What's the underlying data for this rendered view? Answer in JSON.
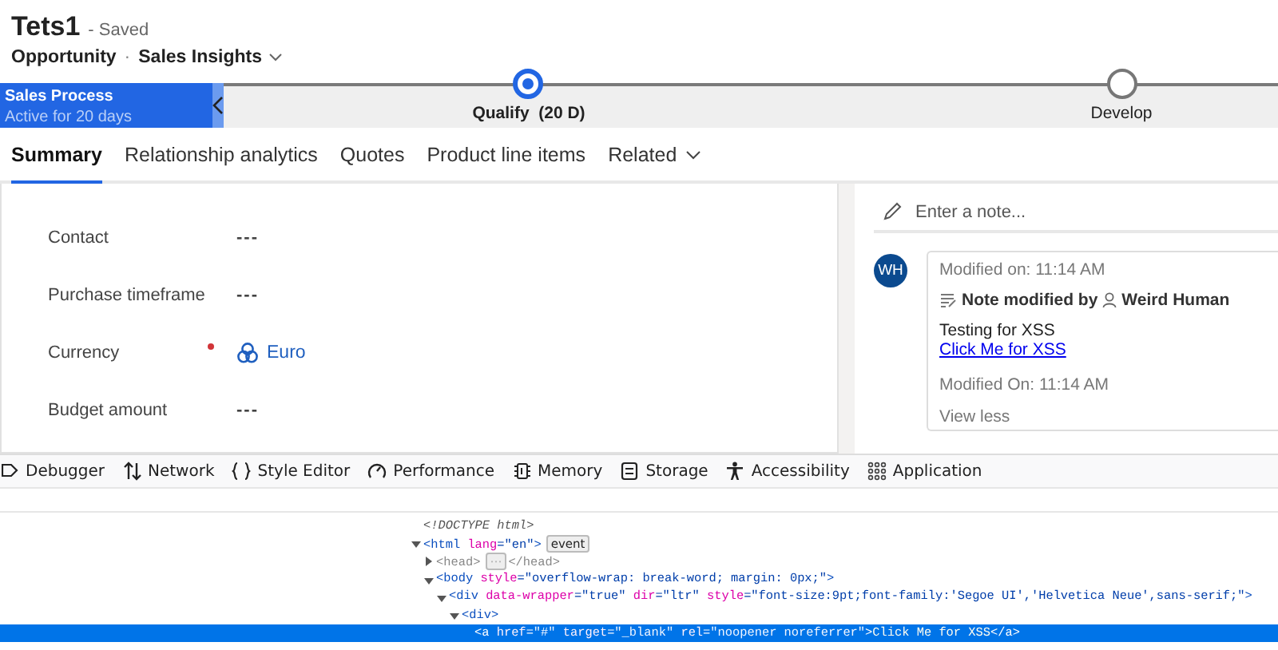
{
  "header": {
    "title": "Tets1",
    "save_status": "- Saved",
    "entity": "Opportunity",
    "separator": "·",
    "form_selector": "Sales Insights"
  },
  "process": {
    "name": "Sales Process",
    "duration": "Active for 20 days",
    "stages": [
      {
        "label": "Qualify",
        "days": "(20 D)",
        "selected": true
      },
      {
        "label": "Develop",
        "selected": false
      }
    ]
  },
  "tabs": [
    {
      "label": "Summary",
      "selected": true,
      "kind": "tab"
    },
    {
      "label": "Relationship analytics",
      "selected": false,
      "kind": "tab"
    },
    {
      "label": "Quotes",
      "selected": false,
      "kind": "tab"
    },
    {
      "label": "Product line items",
      "selected": false,
      "kind": "tab"
    },
    {
      "label": "Related",
      "selected": false,
      "kind": "menu"
    }
  ],
  "fields": [
    {
      "label": "Contact",
      "value": "---",
      "required": false,
      "kind": "text"
    },
    {
      "label": "Purchase timeframe",
      "value": "---",
      "required": false,
      "kind": "text"
    },
    {
      "label": "Currency",
      "value": "Euro",
      "required": true,
      "kind": "lookup"
    },
    {
      "label": "Budget amount",
      "value": "---",
      "required": false,
      "kind": "text"
    }
  ],
  "notes": {
    "placeholder": "Enter a note...",
    "entries": [
      {
        "initials": "WH",
        "modified": "Modified on: 11:14 AM",
        "action": "Note modified by",
        "author": "Weird Human",
        "body": "Testing for XSS",
        "link": "Click Me for XSS",
        "footer": "Modified On: 11:14 AM",
        "toggle": "View less"
      }
    ]
  },
  "devtools": {
    "tools": [
      {
        "label": "Debugger",
        "kind": "debugger"
      },
      {
        "label": "Network",
        "kind": "network"
      },
      {
        "label": "Style Editor",
        "kind": "style"
      },
      {
        "label": "Performance",
        "kind": "performance"
      },
      {
        "label": "Memory",
        "kind": "memory"
      },
      {
        "label": "Storage",
        "kind": "storage"
      },
      {
        "label": "Accessibility",
        "kind": "accessibility"
      },
      {
        "label": "Application",
        "kind": "application"
      }
    ],
    "dom_tree": [
      {
        "kind": "leaf",
        "selected": false,
        "dimmed": false,
        "tokens": [
          {
            "kind": "doctype",
            "text": "<!DOCTYPE html>"
          }
        ]
      },
      {
        "kind": "parent",
        "expanded": true,
        "selected": false,
        "dimmed": false,
        "tokens": [
          {
            "kind": "tag",
            "text": "<html"
          },
          {
            "kind": "attr",
            "text": " lang"
          },
          {
            "kind": "value",
            "text": "=\"en\""
          },
          {
            "kind": "tag",
            "text": ">"
          },
          {
            "kind": "badge",
            "text": "event"
          }
        ],
        "children": [
          {
            "kind": "parent",
            "expanded": false,
            "selected": false,
            "dimmed": true,
            "tokens": [
              {
                "kind": "tag",
                "text": "<head>"
              },
              {
                "kind": "badge",
                "text": "⋯"
              },
              {
                "kind": "tag",
                "text": "</head>"
              }
            ]
          },
          {
            "kind": "parent",
            "expanded": true,
            "selected": false,
            "dimmed": false,
            "tokens": [
              {
                "kind": "tag",
                "text": "<body"
              },
              {
                "kind": "attr",
                "text": " style"
              },
              {
                "kind": "value",
                "text": "=\"overflow-wrap: break-word; margin: 0px;\""
              },
              {
                "kind": "tag",
                "text": ">"
              }
            ],
            "children": [
              {
                "kind": "parent",
                "expanded": true,
                "selected": false,
                "dimmed": false,
                "tokens": [
                  {
                    "kind": "tag",
                    "text": "<div"
                  },
                  {
                    "kind": "attr",
                    "text": " data-wrapper"
                  },
                  {
                    "kind": "value",
                    "text": "=\"true\""
                  },
                  {
                    "kind": "attr",
                    "text": " dir"
                  },
                  {
                    "kind": "value",
                    "text": "=\"ltr\""
                  },
                  {
                    "kind": "attr",
                    "text": " style"
                  },
                  {
                    "kind": "value",
                    "text": "=\"font-size:9pt;font-family:'Segoe UI','Helvetica Neue',sans-serif;\""
                  },
                  {
                    "kind": "tag",
                    "text": ">"
                  }
                ],
                "children": [
                  {
                    "kind": "parent",
                    "expanded": true,
                    "selected": false,
                    "dimmed": false,
                    "tokens": [
                      {
                        "kind": "tag",
                        "text": "<div>"
                      }
                    ],
                    "children": [
                      {
                        "kind": "leaf",
                        "selected": true,
                        "dimmed": false,
                        "tokens": [
                          {
                            "kind": "tag",
                            "text": "<a"
                          },
                          {
                            "kind": "attr",
                            "text": " href"
                          },
                          {
                            "kind": "value",
                            "text": "=\"#\""
                          },
                          {
                            "kind": "attr",
                            "text": " target"
                          },
                          {
                            "kind": "value",
                            "text": "=\"_blank\""
                          },
                          {
                            "kind": "attr",
                            "text": " rel"
                          },
                          {
                            "kind": "value",
                            "text": "=\"noopener noreferrer\""
                          },
                          {
                            "kind": "tag",
                            "text": ">"
                          },
                          {
                            "kind": "text",
                            "text": "Click Me for XSS"
                          },
                          {
                            "kind": "tag",
                            "text": "</a>"
                          }
                        ]
                      }
                    ]
                  }
                ]
              }
            ]
          }
        ]
      }
    ]
  }
}
